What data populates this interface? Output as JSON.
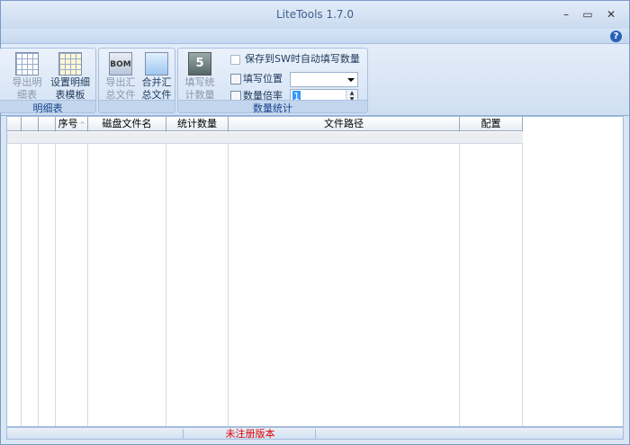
{
  "window": {
    "title": "LiteTools 1.7.0"
  },
  "window_controls": {
    "minimize": "–",
    "maximize": "▭",
    "close": "✕"
  },
  "help": "?",
  "ribbon": {
    "groups": [
      {
        "label": "明细表",
        "buttons": [
          {
            "line1": "导出明",
            "line2": "细表",
            "icon": "table-export-icon",
            "enabled": false
          },
          {
            "line1": "设置明细",
            "line2": "表模板",
            "icon": "template-settings-icon",
            "enabled": true
          }
        ]
      },
      {
        "label": "",
        "buttons": [
          {
            "line1": "导出汇",
            "line2": "总文件",
            "icon": "bom-icon",
            "enabled": false
          },
          {
            "line1": "合并汇",
            "line2": "总文件",
            "icon": "merge-icon",
            "enabled": true
          }
        ]
      },
      {
        "label": "数量统计",
        "buttons": [
          {
            "line1": "填写统",
            "line2": "计数量",
            "icon": "count-five-icon",
            "enabled": false
          }
        ],
        "auto_fill_checkbox": "保存到SW时自动填写数量",
        "fill_position_label": "填写位置",
        "fill_position_value": "",
        "multiplier_label": "数量倍率",
        "multiplier_value": "1"
      }
    ]
  },
  "table": {
    "columns": [
      "",
      "",
      "序号",
      "磁盘文件名",
      "统计数量",
      "文件路径",
      "配置"
    ],
    "sort_indicator": "^"
  },
  "status": {
    "text": "未注册版本"
  }
}
